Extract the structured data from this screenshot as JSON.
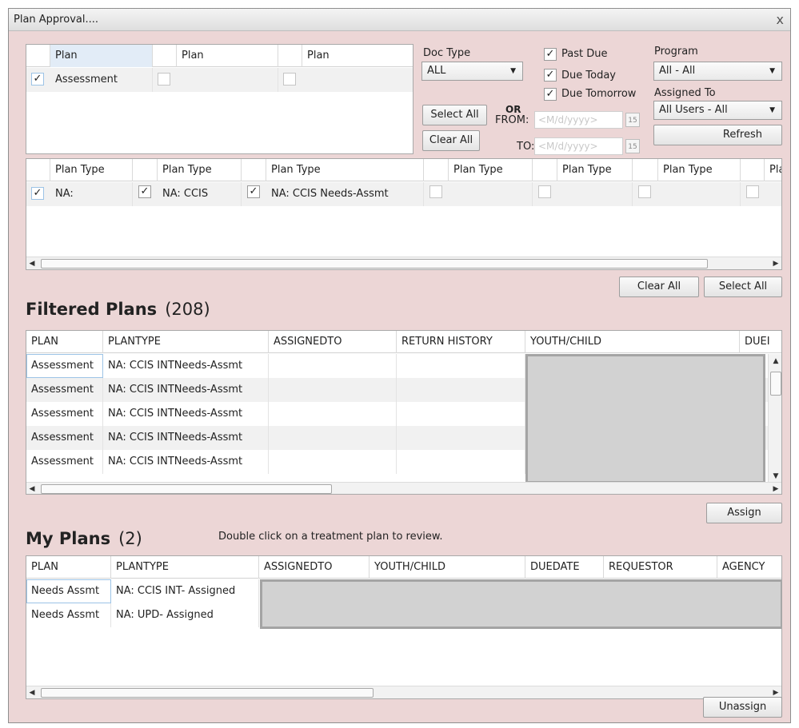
{
  "window": {
    "title": "Plan Approval....",
    "close": "x"
  },
  "plan_grid": {
    "headers": [
      "Plan",
      "Plan",
      "Plan"
    ],
    "row": {
      "checked": [
        true,
        false,
        false
      ],
      "values": [
        "Assessment",
        "",
        ""
      ]
    }
  },
  "doc_type": {
    "label": "Doc Type",
    "value": "ALL"
  },
  "due_filters": {
    "past_due": "Past Due",
    "due_today": "Due Today",
    "due_tomorrow": "Due Tomorrow"
  },
  "date_range": {
    "or_label": "OR",
    "from_label": "FROM:",
    "to_label": "TO:",
    "from_placeholder": "<M/d/yyyy>",
    "to_placeholder": "<M/d/yyyy>",
    "cal_text": "15"
  },
  "program": {
    "label": "Program",
    "value": "All - All"
  },
  "assigned_to": {
    "label": "Assigned To",
    "value": "All Users -  All"
  },
  "buttons": {
    "select_all_top": "Select All",
    "clear_all_top": "Clear All",
    "refresh": "Refresh",
    "clear_all_types": "Clear All",
    "select_all_types": "Select All",
    "assign": "Assign",
    "unassign": "Unassign"
  },
  "plan_type_grid": {
    "headers": [
      "Plan Type",
      "Plan Type",
      "Plan Type",
      "Plan Type",
      "Plan Type",
      "Plan Type",
      "Pla"
    ],
    "row": {
      "checked": [
        true,
        true,
        true,
        false,
        false,
        false,
        false
      ],
      "values": [
        "NA:",
        "NA: CCIS",
        "NA: CCIS Needs-Assmt",
        "",
        "",
        "",
        ""
      ]
    }
  },
  "filtered_plans": {
    "title": "Filtered Plans",
    "count": "(208)",
    "columns": [
      "PLAN",
      "PLANTYPE",
      "ASSIGNEDTO",
      "RETURN HISTORY",
      "YOUTH/CHILD",
      "DUEI"
    ],
    "rows": [
      [
        "Assessment",
        "NA: CCIS INTNeeds-Assmt",
        "",
        ""
      ],
      [
        "Assessment",
        "NA: CCIS INTNeeds-Assmt",
        "",
        ""
      ],
      [
        "Assessment",
        "NA: CCIS INTNeeds-Assmt",
        "",
        ""
      ],
      [
        "Assessment",
        "NA: CCIS INTNeeds-Assmt",
        "",
        ""
      ],
      [
        "Assessment",
        "NA: CCIS INTNeeds-Assmt",
        "",
        ""
      ]
    ]
  },
  "my_plans": {
    "title": "My Plans",
    "count": "(2)",
    "hint": "Double click on a treatment plan to review.",
    "columns": [
      "PLAN",
      "PLANTYPE",
      "ASSIGNEDTO",
      "YOUTH/CHILD",
      "DUEDATE",
      "REQUESTOR",
      "AGENCY"
    ],
    "rows": [
      [
        "Needs Assmt",
        "NA: CCIS INT- Assigned"
      ],
      [
        "Needs Assmt",
        "NA:  UPD- Assigned"
      ]
    ]
  },
  "icons": {
    "check": "✓",
    "left_arrow": "◀",
    "right_arrow": "▶",
    "up_arrow": "▲",
    "down_arrow": "▼"
  }
}
